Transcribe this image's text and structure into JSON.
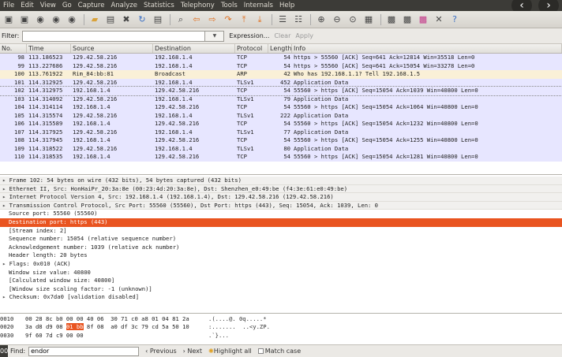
{
  "menu": [
    "File",
    "Edit",
    "View",
    "Go",
    "Capture",
    "Analyze",
    "Statistics",
    "Telephony",
    "Tools",
    "Internals",
    "Help"
  ],
  "filter": {
    "label": "Filter:",
    "value": "",
    "expression": "Expression...",
    "clear": "Clear",
    "apply": "Apply"
  },
  "columns": [
    "No.",
    "Time",
    "Source",
    "Destination",
    "Protocol",
    "Length",
    "Info"
  ],
  "packets": [
    {
      "no": "98",
      "time": "113.186523",
      "src": "129.42.58.216",
      "dst": "192.168.1.4",
      "proto": "TCP",
      "len": "54",
      "info": "https > 55560 [ACK] Seq=641 Ack=12814 Win=35518 Len=0",
      "cls": "tcp"
    },
    {
      "no": "99",
      "time": "113.227686",
      "src": "129.42.58.216",
      "dst": "192.168.1.4",
      "proto": "TCP",
      "len": "54",
      "info": "https > 55560 [ACK] Seq=641 Ack=15054 Win=33278 Len=0",
      "cls": "tcp"
    },
    {
      "no": "100",
      "time": "113.761922",
      "src": "Rim_84:bb:81",
      "dst": "Broadcast",
      "proto": "ARP",
      "len": "42",
      "info": "Who has 192.168.1.1?  Tell 192.168.1.5",
      "cls": "arp"
    },
    {
      "no": "101",
      "time": "114.312925",
      "src": "129.42.58.216",
      "dst": "192.168.1.4",
      "proto": "TLSv1",
      "len": "452",
      "info": "Application Data",
      "cls": "tls"
    },
    {
      "no": "102",
      "time": "114.312975",
      "src": "192.168.1.4",
      "dst": "129.42.58.216",
      "proto": "TCP",
      "len": "54",
      "info": "55560 > https [ACK] Seq=15054 Ack=1039 Win=40800 Len=0",
      "cls": "sel"
    },
    {
      "no": "103",
      "time": "114.314092",
      "src": "129.42.58.216",
      "dst": "192.168.1.4",
      "proto": "TLSv1",
      "len": "79",
      "info": "Application Data",
      "cls": "tls"
    },
    {
      "no": "104",
      "time": "114.314114",
      "src": "192.168.1.4",
      "dst": "129.42.58.216",
      "proto": "TCP",
      "len": "54",
      "info": "55560 > https [ACK] Seq=15054 Ack=1064 Win=40800 Len=0",
      "cls": "tcp"
    },
    {
      "no": "105",
      "time": "114.315574",
      "src": "129.42.58.216",
      "dst": "192.168.1.4",
      "proto": "TLSv1",
      "len": "222",
      "info": "Application Data",
      "cls": "tls"
    },
    {
      "no": "106",
      "time": "114.315589",
      "src": "192.168.1.4",
      "dst": "129.42.58.216",
      "proto": "TCP",
      "len": "54",
      "info": "55560 > https [ACK] Seq=15054 Ack=1232 Win=40800 Len=0",
      "cls": "tcp"
    },
    {
      "no": "107",
      "time": "114.317925",
      "src": "129.42.58.216",
      "dst": "192.168.1.4",
      "proto": "TLSv1",
      "len": "77",
      "info": "Application Data",
      "cls": "tls"
    },
    {
      "no": "108",
      "time": "114.317945",
      "src": "192.168.1.4",
      "dst": "129.42.58.216",
      "proto": "TCP",
      "len": "54",
      "info": "55560 > https [ACK] Seq=15054 Ack=1255 Win=40800 Len=0",
      "cls": "tcp"
    },
    {
      "no": "109",
      "time": "114.318522",
      "src": "129.42.58.216",
      "dst": "192.168.1.4",
      "proto": "TLSv1",
      "len": "80",
      "info": "Application Data",
      "cls": "tls"
    },
    {
      "no": "110",
      "time": "114.318535",
      "src": "192.168.1.4",
      "dst": "129.42.58.216",
      "proto": "TCP",
      "len": "54",
      "info": "55560 > https [ACK] Seq=15054 Ack=1281 Win=40800 Len=0",
      "cls": "tcp"
    }
  ],
  "details": [
    {
      "text": "Frame 102: 54 bytes on wire (432 bits), 54 bytes captured (432 bits)",
      "cls": "top tri"
    },
    {
      "text": "Ethernet II, Src: HonHaiPr_20:3a:8e (00:23:4d:20:3a:8e), Dst: Shenzhen_e0:49:be (f4:3e:61:e0:49:be)",
      "cls": "top tri"
    },
    {
      "text": "Internet Protocol Version 4, Src: 192.168.1.4 (192.168.1.4), Dst: 129.42.58.216 (129.42.58.216)",
      "cls": "top tri"
    },
    {
      "text": "Transmission Control Protocol, Src Port: 55560 (55560), Dst Port: https (443), Seq: 15054, Ack: 1039, Len: 0",
      "cls": "top tri"
    },
    {
      "text": "Source port: 55560 (55560)",
      "cls": "sub"
    },
    {
      "text": "Destination port: https (443)",
      "cls": "sub hl"
    },
    {
      "text": "[Stream index: 2]",
      "cls": "sub"
    },
    {
      "text": "Sequence number: 15054    (relative sequence number)",
      "cls": "sub"
    },
    {
      "text": "Acknowledgement number: 1039    (relative ack number)",
      "cls": "sub"
    },
    {
      "text": "Header length: 20 bytes",
      "cls": "sub"
    },
    {
      "text": "Flags: 0x010 (ACK)",
      "cls": "tri"
    },
    {
      "text": "Window size value: 40800",
      "cls": "sub"
    },
    {
      "text": "[Calculated window size: 40800]",
      "cls": "sub"
    },
    {
      "text": "[Window size scaling factor: -1 (unknown)]",
      "cls": "sub"
    },
    {
      "text": "Checksum: 0x7da0 [validation disabled]",
      "cls": "tri"
    }
  ],
  "bytes": [
    {
      "off": "0010",
      "pre": "00 28 8c b0 00 00 40 06  30 71 c0 a8 01 04 81 2a",
      "mark": "",
      "post": "",
      "asc": ".(....@. 0q.....*"
    },
    {
      "off": "0020",
      "pre": "3a d8 d9 08 ",
      "mark": "01 bb",
      "post": " 8f 08  a0 df 3c 79 cd 5a 50 10",
      "asc": ":.......  ..<y.ZP."
    },
    {
      "off": "0030",
      "pre": "9f 60 7d c9 00 00",
      "mark": "",
      "post": "",
      "asc": ".`}..."
    }
  ],
  "find": {
    "num": "00",
    "label": "Find:",
    "value": "endor",
    "previous": "Previous",
    "next": "Next",
    "highlight": "Highlight all",
    "matchcase": "Match case"
  }
}
